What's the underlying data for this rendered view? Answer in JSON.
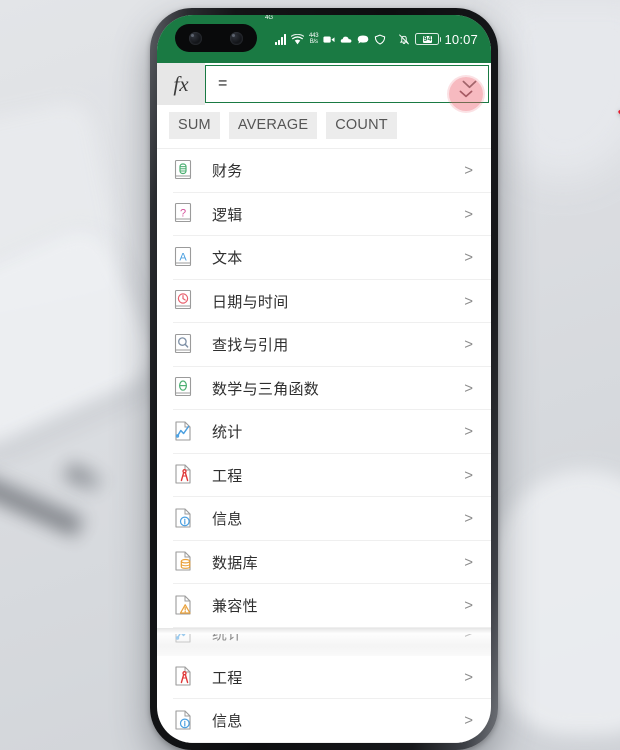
{
  "device": {
    "statusbar": {
      "network_prefix": "4G",
      "data_rate_value": "443",
      "data_rate_unit": "B/s",
      "battery_percent": "94",
      "time": "10:07",
      "icons": [
        "signal-bars-icon",
        "wifi-icon",
        "video-icon",
        "cloud-icon",
        "message-icon",
        "shield-icon",
        "bell-mute-icon",
        "battery-icon"
      ],
      "accent_color": "#1a7a43"
    }
  },
  "formula_bar": {
    "fx_label": "fx",
    "value": "=",
    "placeholder": "",
    "expand_icon": "chevron-down-icon",
    "border_color": "#1a7a43"
  },
  "quick_functions": {
    "chips": [
      "SUM",
      "AVERAGE",
      "COUNT"
    ]
  },
  "categories": {
    "items": [
      {
        "label": "财务",
        "icon": "book-finance-icon",
        "color": "#4caf72",
        "chevron": ">"
      },
      {
        "label": "逻辑",
        "icon": "book-question-icon",
        "color": "#d5509c",
        "chevron": ">"
      },
      {
        "label": "文本",
        "icon": "book-text-a-icon",
        "color": "#4a9fe0",
        "chevron": ">"
      },
      {
        "label": "日期与时间",
        "icon": "book-clock-icon",
        "color": "#e8616e",
        "chevron": ">"
      },
      {
        "label": "查找与引用",
        "icon": "book-search-icon",
        "color": "#7d8fa5",
        "chevron": ">"
      },
      {
        "label": "数学与三角函数",
        "icon": "book-theta-icon",
        "color": "#4caf72",
        "chevron": ">"
      },
      {
        "label": "统计",
        "icon": "page-linechart-icon",
        "color": "#4a9fe0",
        "chevron": ">"
      },
      {
        "label": "工程",
        "icon": "page-compass-icon",
        "color": "#e03a3a",
        "chevron": ">"
      },
      {
        "label": "信息",
        "icon": "page-info-icon",
        "color": "#4a9fe0",
        "chevron": ">"
      },
      {
        "label": "数据库",
        "icon": "page-database-icon",
        "color": "#e9a13b",
        "chevron": ">"
      },
      {
        "label": "兼容性",
        "icon": "page-warning-icon",
        "color": "#e9a13b",
        "chevron": ">"
      }
    ],
    "ghost_items": [
      {
        "label": "统计",
        "icon": "page-linechart-icon",
        "color": "#4a9fe0",
        "chevron": ">"
      }
    ],
    "trailing_items": [
      {
        "label": "工程",
        "icon": "page-compass-icon",
        "color": "#e03a3a",
        "chevron": ">"
      },
      {
        "label": "信息",
        "icon": "page-info-icon",
        "color": "#4a9fe0",
        "chevron": ">"
      }
    ]
  },
  "pointer": {
    "tap_indicator": "tap-circle-indicator",
    "cursor": "arrow-cursor",
    "color": "#e8192c"
  }
}
